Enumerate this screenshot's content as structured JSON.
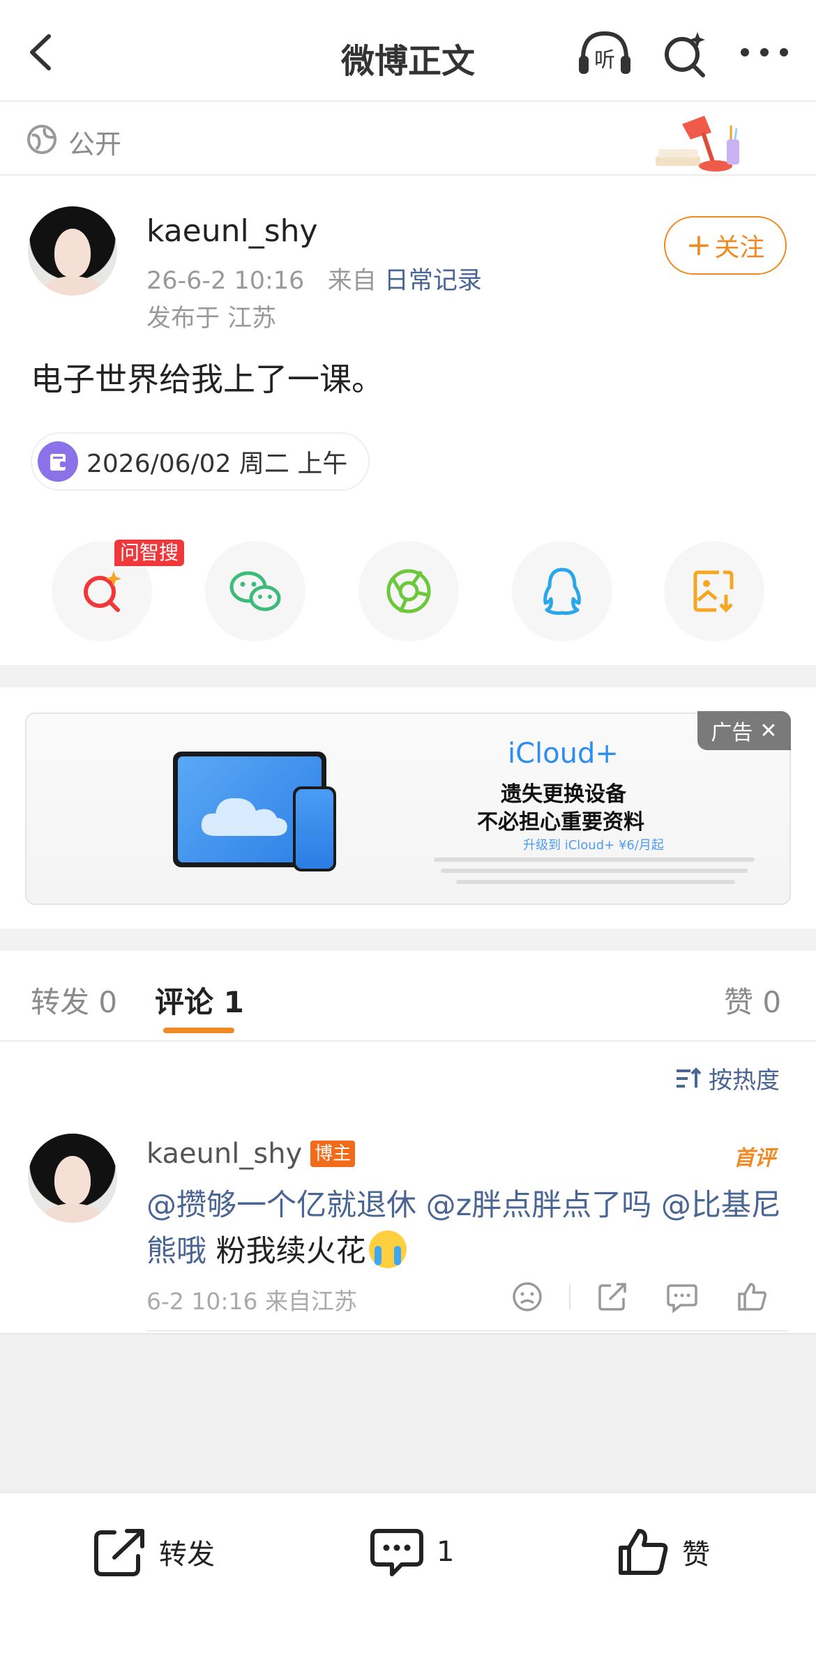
{
  "header": {
    "title": "微博正文",
    "listen_label": "听"
  },
  "visibility": {
    "label": "公开"
  },
  "post": {
    "author": "kaeunl_shy",
    "time": "26-6-2 10:16",
    "from_prefix": "来自",
    "source": "日常记录",
    "location": "发布于 江苏",
    "follow_label": "关注",
    "text": "电子世界给我上了一课。",
    "date_chip": "2026/06/02 周二 上午"
  },
  "share": {
    "badge": "问智搜"
  },
  "ad": {
    "badge": "广告",
    "brand": "iCloud+",
    "line1": "遗失更换设备",
    "line2": "不必担心重要资料",
    "line3": "升级到 iCloud+ ¥6/月起"
  },
  "tabs": {
    "repost": "转发 0",
    "comments": "评论 1",
    "likes": "赞 0"
  },
  "sort": {
    "label": "按热度"
  },
  "comment": {
    "author": "kaeunl_shy",
    "author_badge": "博主",
    "first_label": "首评",
    "mention1": "@攒够一个亿就退休",
    "mention2": "@z胖点胖点了吗",
    "mention3": "@比基尼熊哦",
    "text_tail": " 粉我续火花",
    "meta": "6-2 10:16  来自江苏"
  },
  "bottom_bar": {
    "repost": "转发",
    "comment_count": "1",
    "like": "赞"
  },
  "colors": {
    "accent_orange": "#f08a24",
    "link_blue": "#496593",
    "badge_red": "#f0383a"
  }
}
